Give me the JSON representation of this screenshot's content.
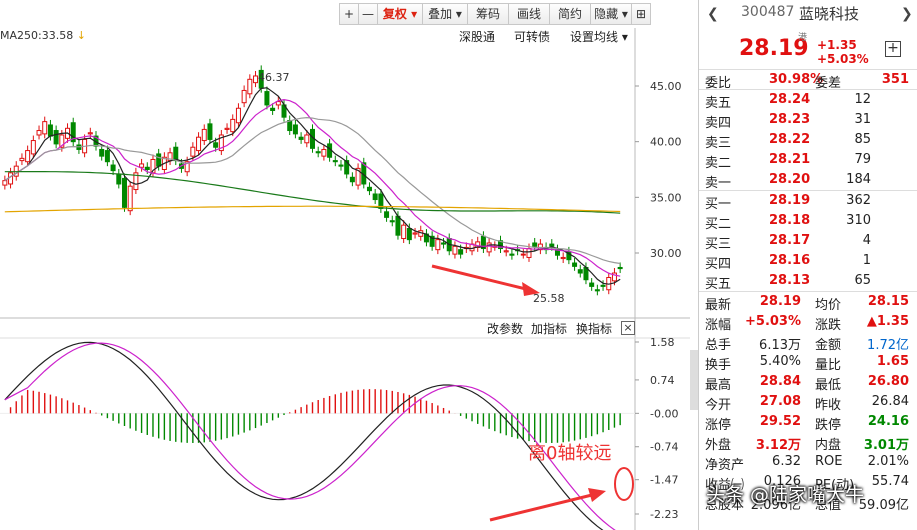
{
  "toolbar": {
    "plus": "+",
    "minus": "—",
    "restore": "复权",
    "overlay": "叠加",
    "chips": "筹码",
    "draw": "画线",
    "bond": "简约",
    "hide": "隐藏",
    "more": "⊞"
  },
  "main_chart": {
    "ma_label": "MA250:33.58",
    "links": [
      "深股通",
      "可转债",
      "设置均线"
    ],
    "y_ticks": [
      "45.00",
      "40.00",
      "35.00",
      "30.00"
    ],
    "high_label": "46.37",
    "low_label": "25.58"
  },
  "macd": {
    "buttons": [
      "改参数",
      "加指标",
      "换指标"
    ],
    "close": "×",
    "y_ticks": [
      "1.58",
      "0.74",
      "-0.00",
      "-0.74",
      "-1.47",
      "-2.23"
    ],
    "annotation": "离0轴较远"
  },
  "quote": {
    "code": "300487",
    "name": "蓝晓科技",
    "hk": "港",
    "price": "28.19",
    "change": "+1.35",
    "change_pct": "+5.03%",
    "weibi_label": "委比",
    "weibi": "30.98%",
    "weicha_label": "委差",
    "weicha": "351",
    "asks": [
      {
        "label": "卖五",
        "price": "28.24",
        "vol": "12"
      },
      {
        "label": "卖四",
        "price": "28.23",
        "vol": "31"
      },
      {
        "label": "卖三",
        "price": "28.22",
        "vol": "85"
      },
      {
        "label": "卖二",
        "price": "28.21",
        "vol": "79"
      },
      {
        "label": "卖一",
        "price": "28.20",
        "vol": "184"
      }
    ],
    "bids": [
      {
        "label": "买一",
        "price": "28.19",
        "vol": "362"
      },
      {
        "label": "买二",
        "price": "28.18",
        "vol": "310"
      },
      {
        "label": "买三",
        "price": "28.17",
        "vol": "4"
      },
      {
        "label": "买四",
        "price": "28.16",
        "vol": "1"
      },
      {
        "label": "买五",
        "price": "28.13",
        "vol": "65"
      }
    ],
    "stats": [
      {
        "l1": "最新",
        "v1": "28.19",
        "c1": "red",
        "l2": "均价",
        "v2": "28.15",
        "c2": "red"
      },
      {
        "l1": "涨幅",
        "v1": "+5.03%",
        "c1": "red",
        "l2": "涨跌",
        "v2": "▲1.35",
        "c2": "red"
      },
      {
        "l1": "总手",
        "v1": "6.13万",
        "c1": "blk",
        "l2": "金额",
        "v2": "1.72亿",
        "c2": "blue"
      },
      {
        "l1": "换手",
        "v1": "5.40%",
        "c1": "blk",
        "l2": "量比",
        "v2": "1.65",
        "c2": "red"
      },
      {
        "l1": "最高",
        "v1": "28.84",
        "c1": "red",
        "l2": "最低",
        "v2": "26.80",
        "c2": "red"
      },
      {
        "l1": "今开",
        "v1": "27.08",
        "c1": "red",
        "l2": "昨收",
        "v2": "26.84",
        "c2": "blk"
      },
      {
        "l1": "涨停",
        "v1": "29.52",
        "c1": "red",
        "l2": "跌停",
        "v2": "24.16",
        "c2": "green"
      },
      {
        "l1": "外盘",
        "v1": "3.12万",
        "c1": "red",
        "l2": "内盘",
        "v2": "3.01万",
        "c2": "green"
      },
      {
        "l1": "净资产",
        "v1": "6.32",
        "c1": "blk",
        "l2": "ROE",
        "v2": "2.01%",
        "c2": "blk"
      },
      {
        "l1": "收益㈠",
        "v1": "0.126",
        "c1": "blk",
        "l2": "PE(动)",
        "v2": "55.74",
        "c2": "blk"
      },
      {
        "l1": "总股本",
        "v1": "2.096亿",
        "c1": "blk",
        "l2": "总值",
        "v2": "59.09亿",
        "c2": "blk"
      }
    ]
  },
  "watermark": "头条 @陆家嘴大牛",
  "colors": {
    "up": "#e01010",
    "down": "#008800",
    "accent": "#d21"
  }
}
